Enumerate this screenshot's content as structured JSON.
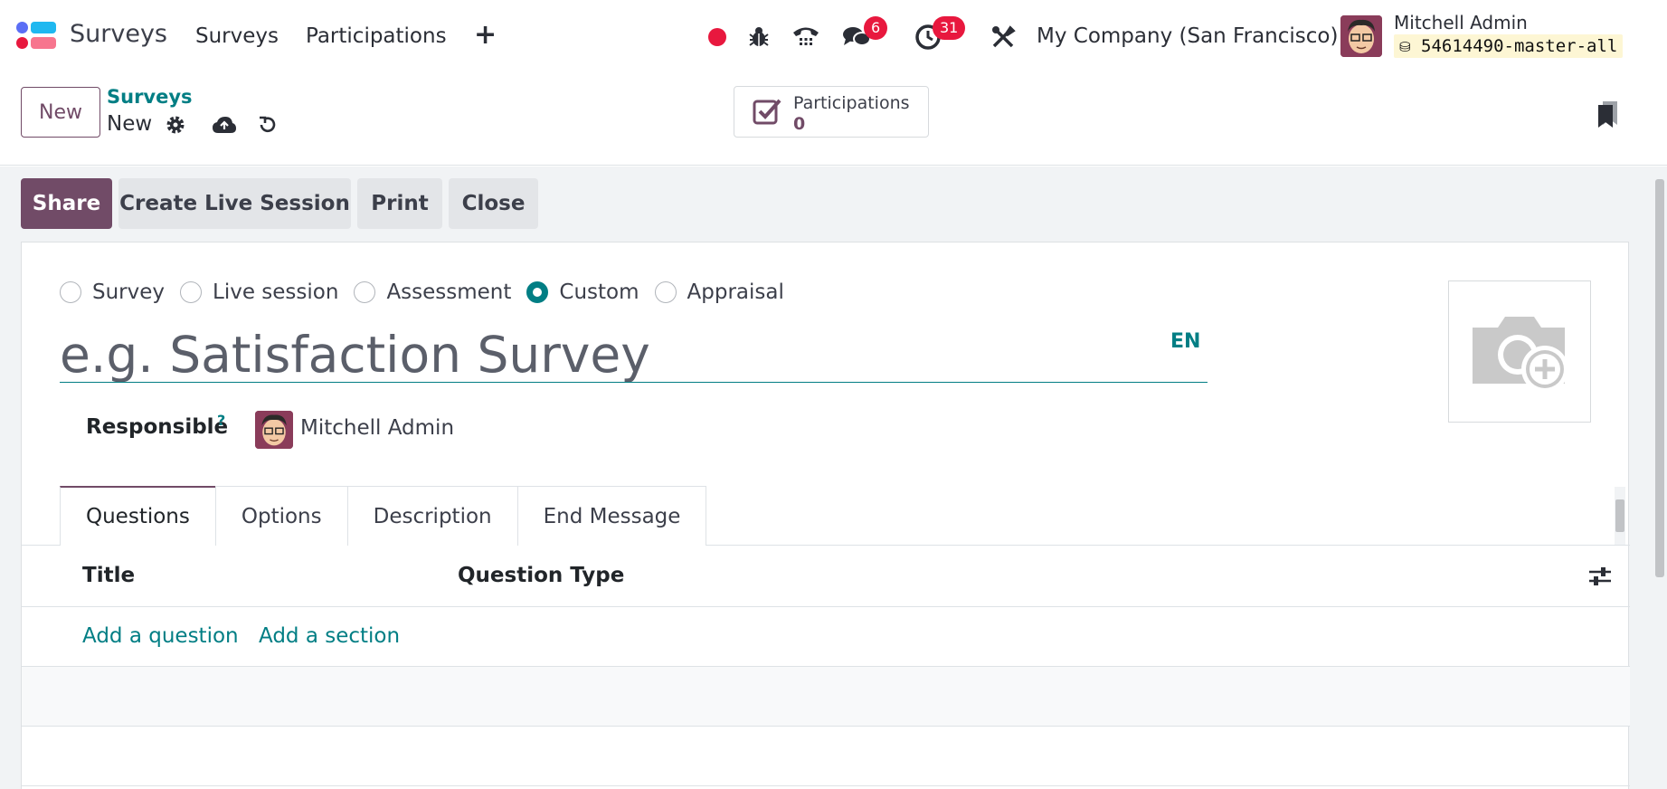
{
  "navbar": {
    "brand": "Surveys",
    "menu": [
      "Surveys",
      "Participations"
    ],
    "plus": "+",
    "messages_badge": "6",
    "activities_badge": "31",
    "company": "My Company (San Francisco)",
    "user_name": "Mitchell Admin",
    "database": "54614490-master-all"
  },
  "control_panel": {
    "new_button": "New",
    "breadcrumb_parent": "Surveys",
    "breadcrumb_current": "New",
    "smart_button_label": "Participations",
    "smart_button_value": "0"
  },
  "statusbar": {
    "share": "Share",
    "live_session": "Create Live Session",
    "print": "Print",
    "close": "Close"
  },
  "form": {
    "survey_types": [
      {
        "label": "Survey",
        "checked": false
      },
      {
        "label": "Live session",
        "checked": false
      },
      {
        "label": "Assessment",
        "checked": false
      },
      {
        "label": "Custom",
        "checked": true
      },
      {
        "label": "Appraisal",
        "checked": false
      }
    ],
    "title_placeholder": "e.g. Satisfaction Survey",
    "title_value": "",
    "lang": "EN",
    "responsible_label": "Responsible",
    "responsible_help": "?",
    "responsible_name": "Mitchell Admin",
    "tabs": [
      "Questions",
      "Options",
      "Description",
      "End Message"
    ],
    "active_tab": "Questions",
    "columns": [
      "Title",
      "Question Type"
    ],
    "add_question": "Add a question",
    "add_section": "Add a section"
  },
  "colors": {
    "primary": "#714b67",
    "link": "#017e84",
    "badge": "#e8183e"
  }
}
